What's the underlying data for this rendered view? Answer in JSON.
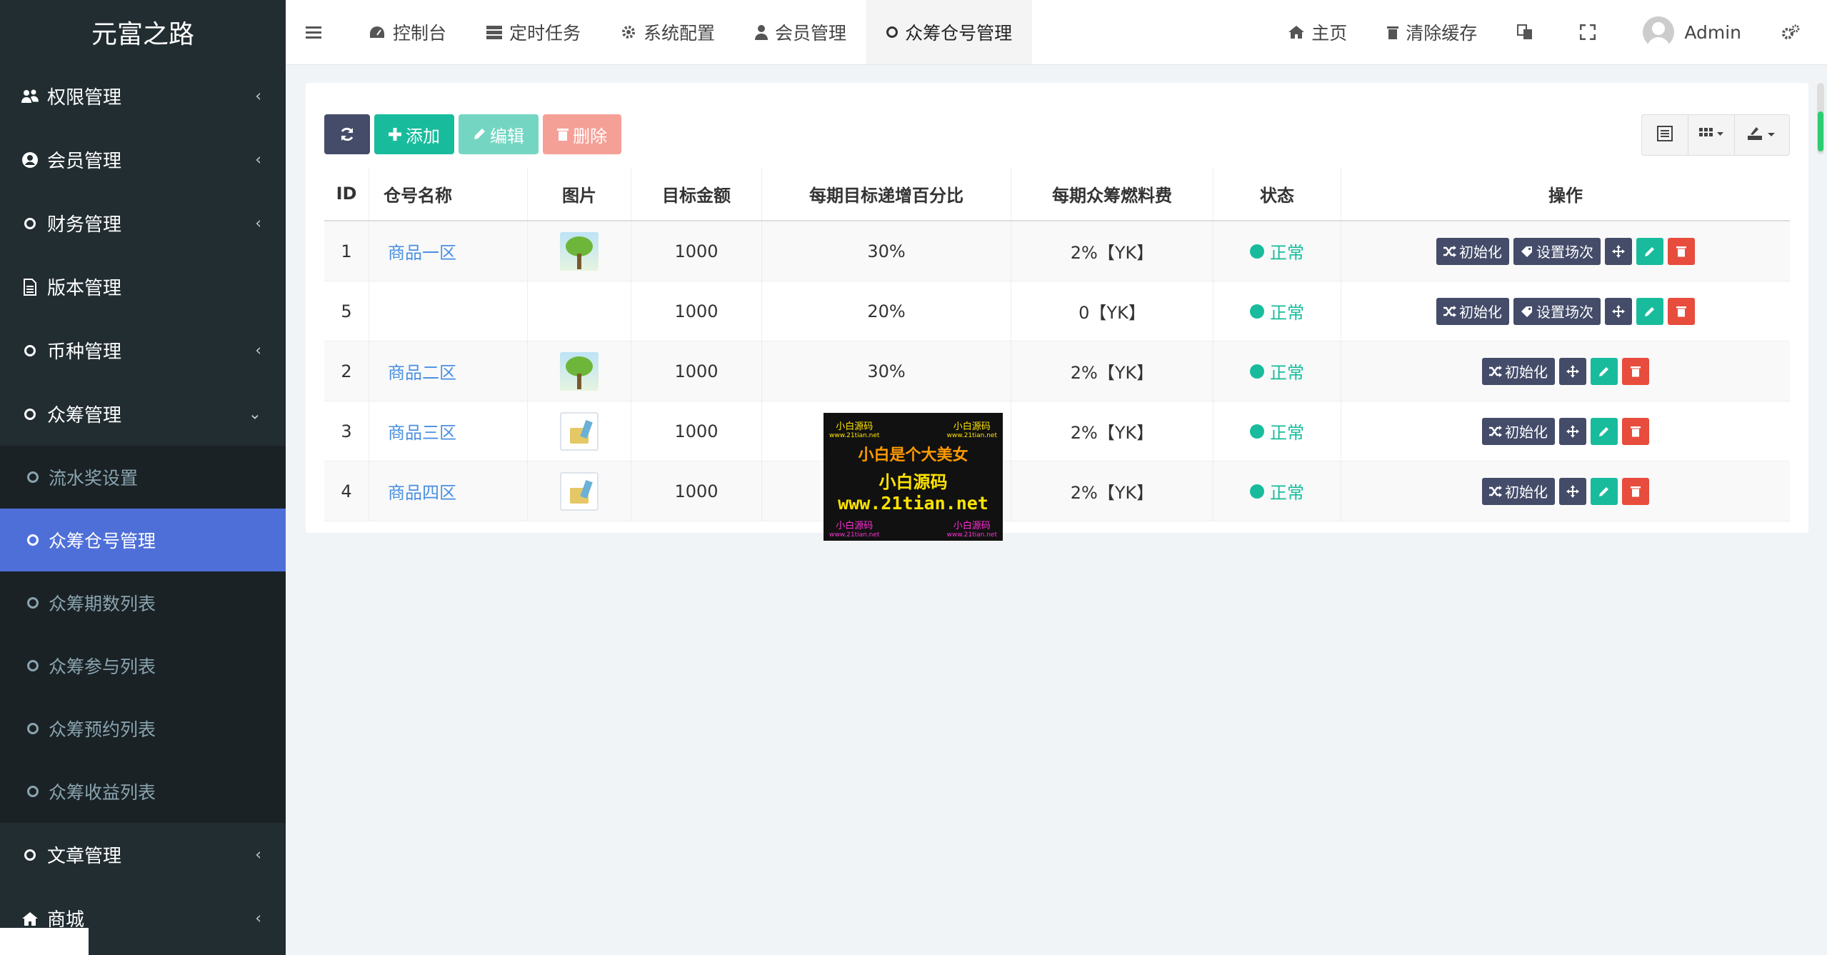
{
  "sidebar": {
    "brand": "元富之路",
    "items": [
      {
        "label": "权限管理",
        "icon": "users-icon"
      },
      {
        "label": "会员管理",
        "icon": "user-circle-icon"
      },
      {
        "label": "财务管理",
        "icon": "circle-icon"
      },
      {
        "label": "版本管理",
        "icon": "file-icon"
      },
      {
        "label": "币种管理",
        "icon": "circle-icon"
      },
      {
        "label": "众筹管理",
        "icon": "circle-icon",
        "expanded": true
      }
    ],
    "submenu": [
      {
        "label": "流水奖设置"
      },
      {
        "label": "众筹仓号管理",
        "active": true
      },
      {
        "label": "众筹期数列表"
      },
      {
        "label": "众筹参与列表"
      },
      {
        "label": "众筹预约列表"
      },
      {
        "label": "众筹收益列表"
      }
    ],
    "items_after": [
      {
        "label": "文章管理",
        "icon": "circle-icon"
      },
      {
        "label": "商城",
        "icon": "home-icon"
      }
    ]
  },
  "topbar": {
    "tabs": [
      {
        "label": "控制台",
        "icon": "dashboard-icon"
      },
      {
        "label": "定时任务",
        "icon": "tasks-icon"
      },
      {
        "label": "系统配置",
        "icon": "gear-icon"
      },
      {
        "label": "会员管理",
        "icon": "user-icon"
      },
      {
        "label": "众筹仓号管理",
        "icon": "circle-icon",
        "active": true
      }
    ],
    "right": {
      "home": "主页",
      "clear_cache": "清除缓存",
      "user": "Admin"
    }
  },
  "toolbar": {
    "add": "添加",
    "edit": "编辑",
    "delete": "删除"
  },
  "table": {
    "headers": [
      "ID",
      "仓号名称",
      "图片",
      "目标金额",
      "每期目标递增百分比",
      "每期众筹燃料费",
      "状态",
      "操作"
    ],
    "rows": [
      {
        "id": "1",
        "name": "商品一区",
        "image": "tree",
        "target": "1000",
        "pct": "30%",
        "fee": "2%【YK】",
        "status": "正常",
        "has_scene": true
      },
      {
        "id": "5",
        "name": "",
        "image": "",
        "target": "1000",
        "pct": "20%",
        "fee": "0【YK】",
        "status": "正常",
        "has_scene": true
      },
      {
        "id": "2",
        "name": "商品二区",
        "image": "tree",
        "target": "1000",
        "pct": "30%",
        "fee": "2%【YK】",
        "status": "正常",
        "has_scene": false
      },
      {
        "id": "3",
        "name": "商品三区",
        "image": "doc",
        "target": "1000",
        "pct": "",
        "fee": "2%【YK】",
        "status": "正常",
        "has_scene": false
      },
      {
        "id": "4",
        "name": "商品四区",
        "image": "doc",
        "target": "1000",
        "pct": "",
        "fee": "2%【YK】",
        "status": "正常",
        "has_scene": false
      }
    ],
    "op_init": "初始化",
    "op_scene": "设置场次"
  },
  "watermark": {
    "top_left": "小白源码",
    "top_left_url": "www.21tian.net",
    "top_right": "小白源码",
    "top_right_url": "www.21tian.net",
    "line1": "小白是个大美女",
    "line2": "小白源码",
    "line3": "www.21tian.net",
    "bottom_left": "小白源码",
    "bottom_left_url": "www.21tian.net",
    "bottom_right": "小白源码",
    "bottom_right_url": "www.21tian.net"
  },
  "colors": {
    "sidebar_bg": "#222d32",
    "active_menu": "#4e6fd8",
    "success": "#18bc9c",
    "danger": "#e74c3c",
    "dark_btn": "#444c69"
  }
}
